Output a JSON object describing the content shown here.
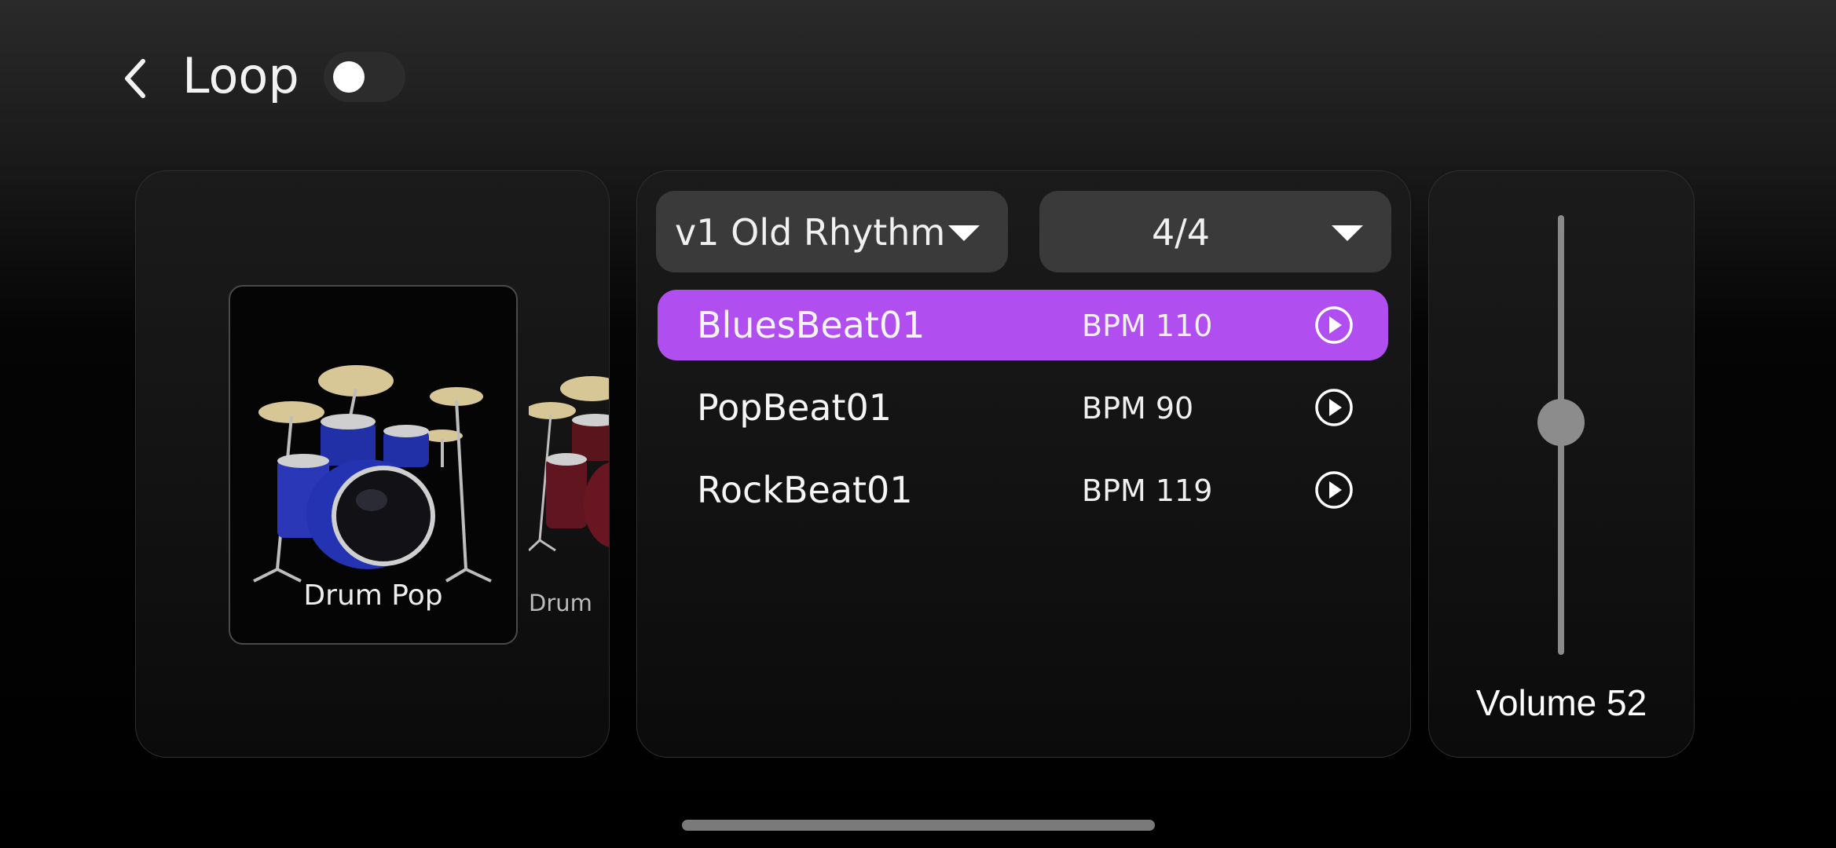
{
  "header": {
    "title": "Loop",
    "loop_toggle_on": false
  },
  "instruments": [
    {
      "name": "Drum Pop",
      "selected": true,
      "icon": "drum-kit-blue"
    },
    {
      "name": "Drum",
      "selected": false,
      "icon": "drum-kit-red"
    }
  ],
  "selectors": {
    "rhythm": "v1 Old Rhythm",
    "time_signature": "4/4"
  },
  "beats": [
    {
      "name": "BluesBeat01",
      "bpm": "BPM 110",
      "selected": true
    },
    {
      "name": "PopBeat01",
      "bpm": "BPM 90",
      "selected": false
    },
    {
      "name": "RockBeat01",
      "bpm": "BPM 119",
      "selected": false
    }
  ],
  "volume": {
    "label": "Volume 52",
    "level": 52
  },
  "colors": {
    "accent": "#b04ef0",
    "background": "#000000",
    "panel": "#111111"
  }
}
